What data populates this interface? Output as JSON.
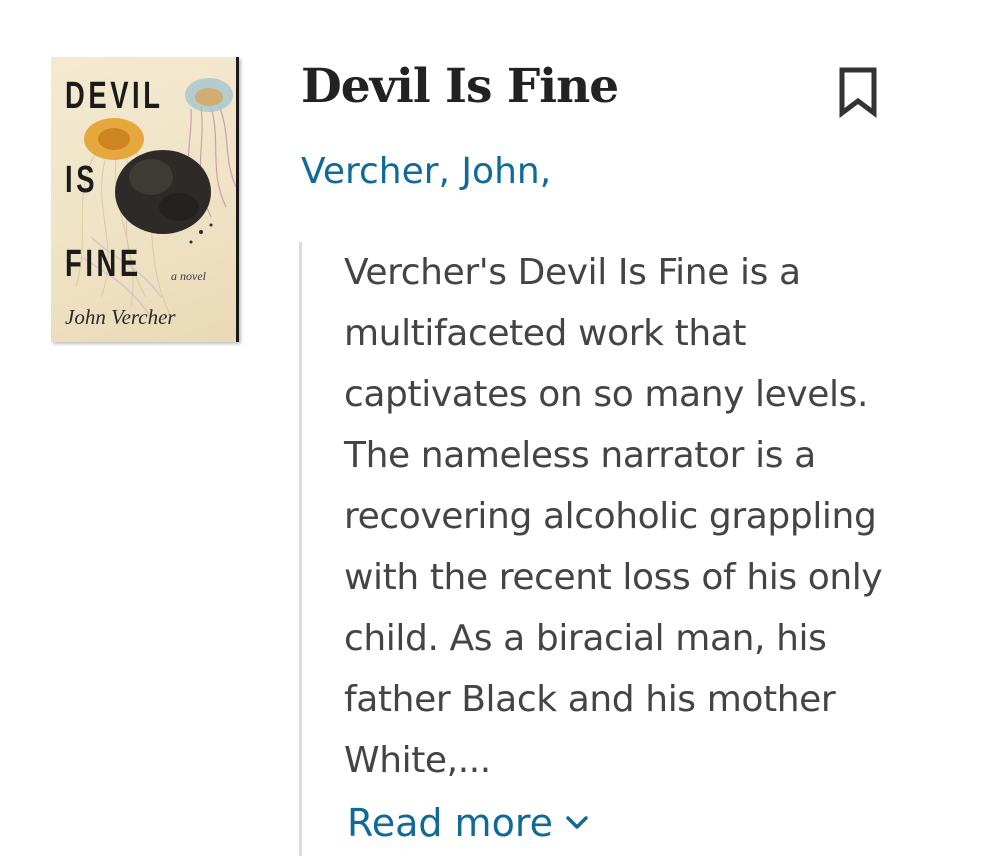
{
  "book": {
    "title": "Devil Is Fine",
    "author": "Vercher, John,",
    "cover": {
      "title_words": [
        "DEVIL",
        "IS",
        "FINE"
      ],
      "subtitle": "a novel",
      "author": "John Vercher"
    },
    "description": "Vercher's Devil Is Fine is a multifaceted work that captivates on so many levels. The nameless narrator is a recovering alcoholic grappling with the recent loss of his only child. As a biracial man, his father Black and his mother White,...",
    "read_more_label": "Read more"
  },
  "icons": {
    "bookmark": "bookmark-icon",
    "read_more": "chevron-down-icon"
  },
  "colors": {
    "link": "#0f6a9a",
    "title": "#222222",
    "body_text": "#444444",
    "divider": "#dddddd"
  }
}
